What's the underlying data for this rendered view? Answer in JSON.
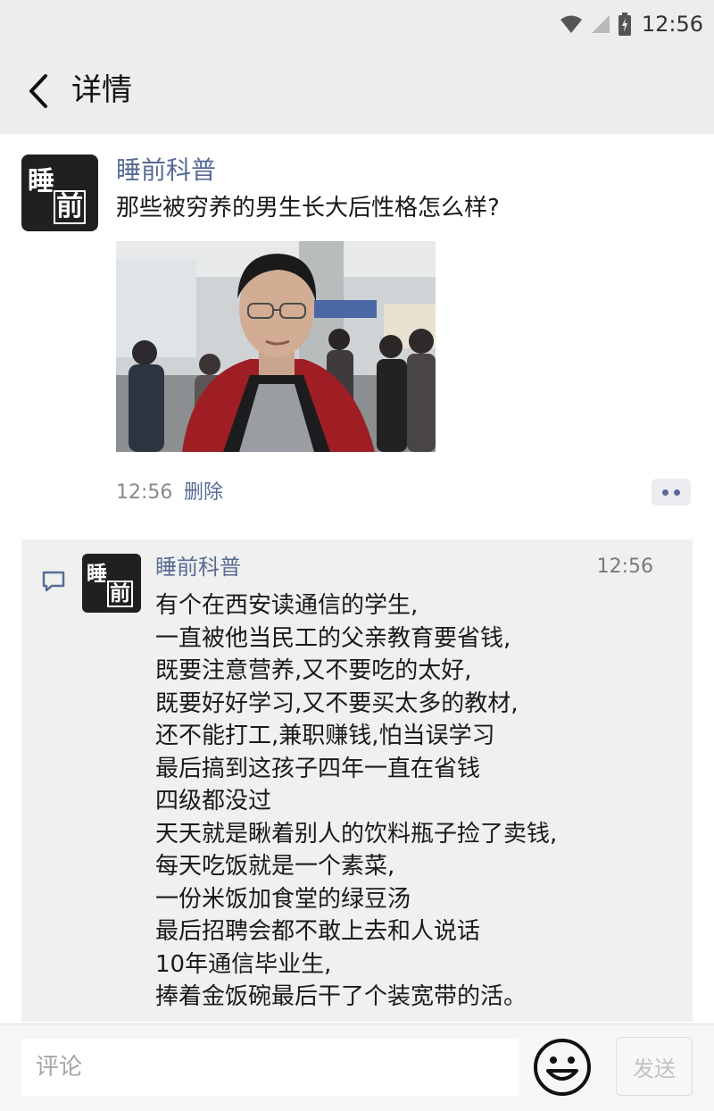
{
  "status_bar": {
    "time": "12:56",
    "icons": [
      "wifi-icon",
      "cellular-signal-icon",
      "battery-charging-icon"
    ]
  },
  "nav": {
    "back_icon": "chevron-left-icon",
    "title": "详情"
  },
  "post": {
    "author": "睡前科普",
    "avatar_text": [
      "睡",
      "前"
    ],
    "text": "那些被穷养的男生长大后性格怎么样?",
    "time": "12:56",
    "delete_label": "删除",
    "more_icon": "more-dots-icon"
  },
  "comment": {
    "icon": "comment-bubble-icon",
    "author": "睡前科普",
    "avatar_text": [
      "睡",
      "前"
    ],
    "time": "12:56",
    "lines": [
      "有个在西安读通信的学生,",
      "一直被他当民工的父亲教育要省钱,",
      "既要注意营养,又不要吃的太好,",
      "既要好好学习,又不要买太多的教材,",
      "还不能打工,兼职赚钱,怕当误学习",
      "最后搞到这孩子四年一直在省钱",
      "四级都没过",
      "天天就是瞅着别人的饮料瓶子捡了卖钱,",
      "每天吃饭就是一个素菜,",
      "一份米饭加食堂的绿豆汤",
      "最后招聘会都不敢上去和人说话",
      "10年通信毕业生,",
      "捧着金饭碗最后干了个装宽带的活。"
    ]
  },
  "input_bar": {
    "placeholder": "评论",
    "value": "",
    "emoji_icon": "smiley-face-icon",
    "send_label": "发送"
  },
  "colors": {
    "link_blue": "#576b95",
    "header_bg": "#ededed",
    "comment_bg": "#f0f0f0"
  }
}
